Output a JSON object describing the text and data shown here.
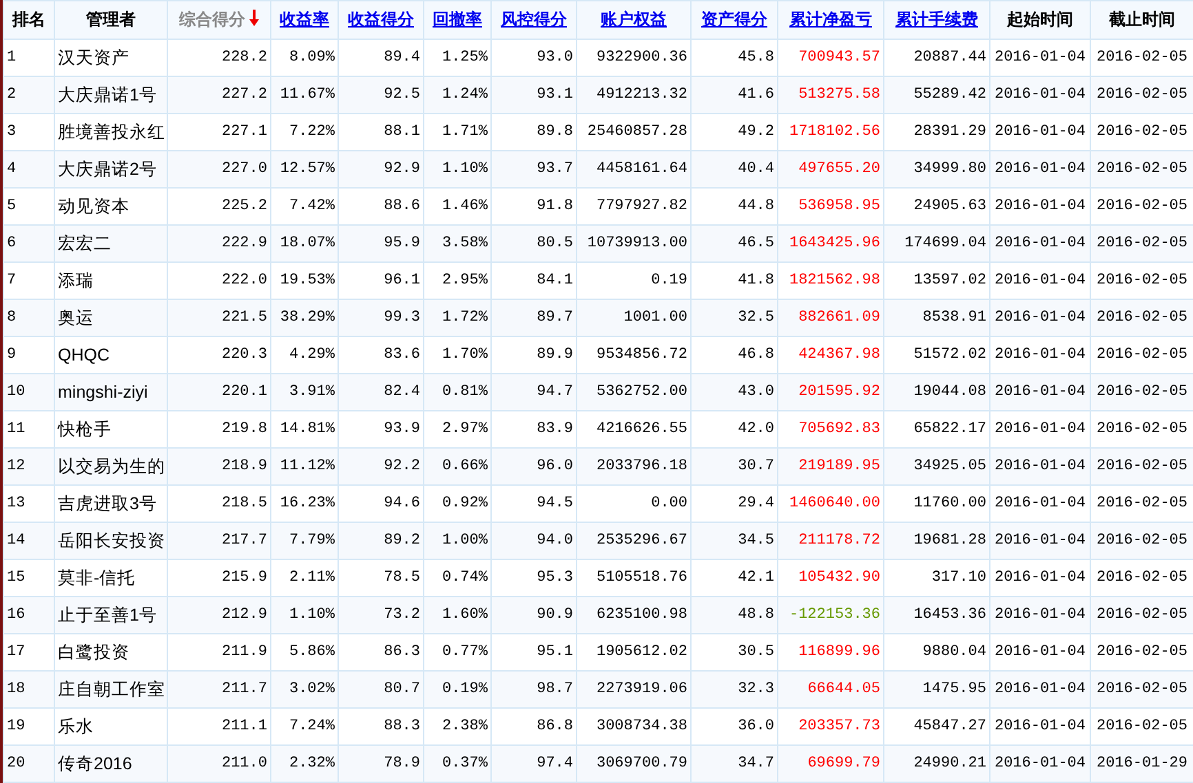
{
  "table": {
    "columns": [
      {
        "label": "排名",
        "kind": "plain"
      },
      {
        "label": "管理者",
        "kind": "plain"
      },
      {
        "label": "综合得分",
        "kind": "sorted"
      },
      {
        "label": "收益率",
        "kind": "link"
      },
      {
        "label": "收益得分",
        "kind": "link"
      },
      {
        "label": "回撤率",
        "kind": "link"
      },
      {
        "label": "风控得分",
        "kind": "link"
      },
      {
        "label": "账户权益",
        "kind": "link"
      },
      {
        "label": "资产得分",
        "kind": "link"
      },
      {
        "label": "累计净盈亏",
        "kind": "link"
      },
      {
        "label": "累计手续费",
        "kind": "link"
      },
      {
        "label": "起始时间",
        "kind": "plain"
      },
      {
        "label": "截止时间",
        "kind": "plain"
      }
    ],
    "rows": [
      {
        "cells": [
          "1",
          "汉天资产",
          "228.2",
          "8.09%",
          "89.4",
          "1.25%",
          "93.0",
          "9322900.36",
          "45.8",
          "700943.57",
          "20887.44",
          "2016-01-04",
          "2016-02-05"
        ],
        "color": "#ff0000"
      },
      {
        "cells": [
          "2",
          "大庆鼎诺1号",
          "227.2",
          "11.67%",
          "92.5",
          "1.24%",
          "93.1",
          "4912213.32",
          "41.6",
          "513275.58",
          "55289.42",
          "2016-01-04",
          "2016-02-05"
        ],
        "color": "#ff0000"
      },
      {
        "cells": [
          "3",
          "胜境善投永红",
          "227.1",
          "7.22%",
          "88.1",
          "1.71%",
          "89.8",
          "25460857.28",
          "49.2",
          "1718102.56",
          "28391.29",
          "2016-01-04",
          "2016-02-05"
        ],
        "color": "#ff0000"
      },
      {
        "cells": [
          "4",
          "大庆鼎诺2号",
          "227.0",
          "12.57%",
          "92.9",
          "1.10%",
          "93.7",
          "4458161.64",
          "40.4",
          "497655.20",
          "34999.80",
          "2016-01-04",
          "2016-02-05"
        ],
        "color": "#ff0000"
      },
      {
        "cells": [
          "5",
          "动见资本",
          "225.2",
          "7.42%",
          "88.6",
          "1.46%",
          "91.8",
          "7797927.82",
          "44.8",
          "536958.95",
          "24905.63",
          "2016-01-04",
          "2016-02-05"
        ],
        "color": "#ff0000"
      },
      {
        "cells": [
          "6",
          "宏宏二",
          "222.9",
          "18.07%",
          "95.9",
          "3.58%",
          "80.5",
          "10739913.00",
          "46.5",
          "1643425.96",
          "174699.04",
          "2016-01-04",
          "2016-02-05"
        ],
        "color": "#ff0000"
      },
      {
        "cells": [
          "7",
          "添瑞",
          "222.0",
          "19.53%",
          "96.1",
          "2.95%",
          "84.1",
          "0.19",
          "41.8",
          "1821562.98",
          "13597.02",
          "2016-01-04",
          "2016-02-05"
        ],
        "color": "#ff0000"
      },
      {
        "cells": [
          "8",
          "奥运",
          "221.5",
          "38.29%",
          "99.3",
          "1.72%",
          "89.7",
          "1001.00",
          "32.5",
          "882661.09",
          "8538.91",
          "2016-01-04",
          "2016-02-05"
        ],
        "color": "#ff0000"
      },
      {
        "cells": [
          "9",
          "QHQC",
          "220.3",
          "4.29%",
          "83.6",
          "1.70%",
          "89.9",
          "9534856.72",
          "46.8",
          "424367.98",
          "51572.02",
          "2016-01-04",
          "2016-02-05"
        ],
        "color": "#ff0000"
      },
      {
        "cells": [
          "10",
          "mingshi-ziyi",
          "220.1",
          "3.91%",
          "82.4",
          "0.81%",
          "94.7",
          "5362752.00",
          "43.0",
          "201595.92",
          "19044.08",
          "2016-01-04",
          "2016-02-05"
        ],
        "color": "#ff0000"
      },
      {
        "cells": [
          "11",
          "快枪手",
          "219.8",
          "14.81%",
          "93.9",
          "2.97%",
          "83.9",
          "4216626.55",
          "42.0",
          "705692.83",
          "65822.17",
          "2016-01-04",
          "2016-02-05"
        ],
        "color": "#ff0000"
      },
      {
        "cells": [
          "12",
          "以交易为生的",
          "218.9",
          "11.12%",
          "92.2",
          "0.66%",
          "96.0",
          "2033796.18",
          "30.7",
          "219189.95",
          "34925.05",
          "2016-01-04",
          "2016-02-05"
        ],
        "color": "#ff0000"
      },
      {
        "cells": [
          "13",
          "吉虎进取3号",
          "218.5",
          "16.23%",
          "94.6",
          "0.92%",
          "94.5",
          "0.00",
          "29.4",
          "1460640.00",
          "11760.00",
          "2016-01-04",
          "2016-02-05"
        ],
        "color": "#ff0000"
      },
      {
        "cells": [
          "14",
          "岳阳长安投资",
          "217.7",
          "7.79%",
          "89.2",
          "1.00%",
          "94.0",
          "2535296.67",
          "34.5",
          "211178.72",
          "19681.28",
          "2016-01-04",
          "2016-02-05"
        ],
        "color": "#ff0000"
      },
      {
        "cells": [
          "15",
          "莫非-信托",
          "215.9",
          "2.11%",
          "78.5",
          "0.74%",
          "95.3",
          "5105518.76",
          "42.1",
          "105432.90",
          "317.10",
          "2016-01-04",
          "2016-02-05"
        ],
        "color": "#ff0000"
      },
      {
        "cells": [
          "16",
          "止于至善1号",
          "212.9",
          "1.10%",
          "73.2",
          "1.60%",
          "90.9",
          "6235100.98",
          "48.8",
          "-122153.36",
          "16453.36",
          "2016-01-04",
          "2016-02-05"
        ],
        "color": "#669900"
      },
      {
        "cells": [
          "17",
          "白鹭投资",
          "211.9",
          "5.86%",
          "86.3",
          "0.77%",
          "95.1",
          "1905612.02",
          "30.5",
          "116899.96",
          "9880.04",
          "2016-01-04",
          "2016-02-05"
        ],
        "color": "#ff0000"
      },
      {
        "cells": [
          "18",
          "庄自朝工作室",
          "211.7",
          "3.02%",
          "80.7",
          "0.19%",
          "98.7",
          "2273919.06",
          "32.3",
          "66644.05",
          "1475.95",
          "2016-01-04",
          "2016-02-05"
        ],
        "color": "#ff0000"
      },
      {
        "cells": [
          "19",
          "乐水",
          "211.1",
          "7.24%",
          "88.3",
          "2.38%",
          "86.8",
          "3008734.38",
          "36.0",
          "203357.73",
          "45847.27",
          "2016-01-04",
          "2016-02-05"
        ],
        "color": "#ff0000"
      },
      {
        "cells": [
          "20",
          "传奇2016",
          "211.0",
          "2.32%",
          "78.9",
          "0.37%",
          "97.4",
          "3069700.79",
          "34.7",
          "69699.79",
          "24990.21",
          "2016-01-04",
          "2016-01-29"
        ],
        "color": "#ff0000"
      }
    ]
  }
}
